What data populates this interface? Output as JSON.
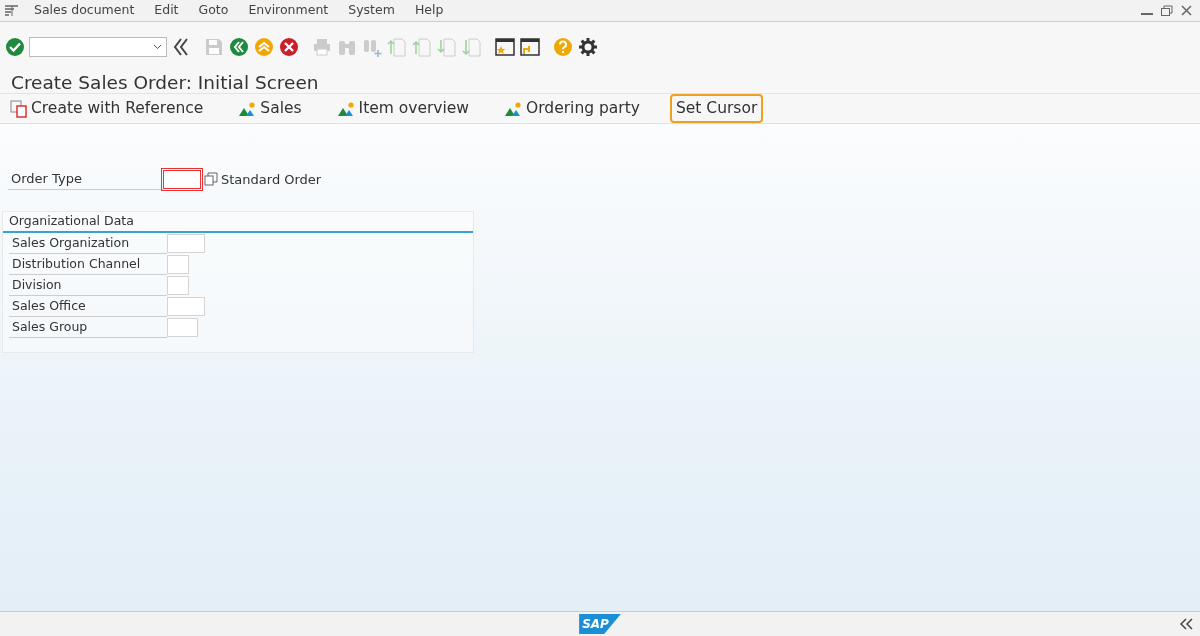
{
  "menu_bar": {
    "items": [
      "Sales document",
      "Edit",
      "Goto",
      "Environment",
      "System",
      "Help"
    ]
  },
  "toolbar": {
    "icons": [
      {
        "kind": "back-nav",
        "disabled": false
      },
      {
        "kind": "save",
        "disabled": true
      },
      {
        "kind": "back",
        "disabled": false
      },
      {
        "kind": "exit",
        "disabled": false
      },
      {
        "kind": "cancel",
        "disabled": false
      },
      {
        "kind": "print",
        "disabled": true
      },
      {
        "kind": "find",
        "disabled": true
      },
      {
        "kind": "find-next",
        "disabled": true
      },
      {
        "kind": "first-page",
        "disabled": true
      },
      {
        "kind": "prev-page",
        "disabled": true
      },
      {
        "kind": "next-page",
        "disabled": true
      },
      {
        "kind": "last-page",
        "disabled": true
      },
      {
        "kind": "new-session",
        "disabled": false
      },
      {
        "kind": "shortcut",
        "disabled": false
      },
      {
        "kind": "help",
        "disabled": false
      },
      {
        "kind": "settings",
        "disabled": false
      }
    ]
  },
  "title": "Create Sales Order: Initial Screen",
  "app_toolbar": [
    {
      "label": "Create with Reference",
      "kind": "reference",
      "highlighted": false
    },
    {
      "label": "Sales",
      "kind": "overview",
      "highlighted": false
    },
    {
      "label": "Item overview",
      "kind": "overview",
      "highlighted": false
    },
    {
      "label": "Ordering party",
      "kind": "overview",
      "highlighted": false
    },
    {
      "label": "Set Cursor",
      "kind": "plain",
      "highlighted": true
    }
  ],
  "order_type": {
    "label": "Order Type",
    "required": true,
    "description": "Standard Order"
  },
  "org_data": {
    "title": "Organizational Data",
    "fields": [
      "Sales Organization",
      "Distribution Channel",
      "Division",
      "Sales Office",
      "Sales Group"
    ]
  },
  "status_bar": {
    "logo": "SAP"
  }
}
